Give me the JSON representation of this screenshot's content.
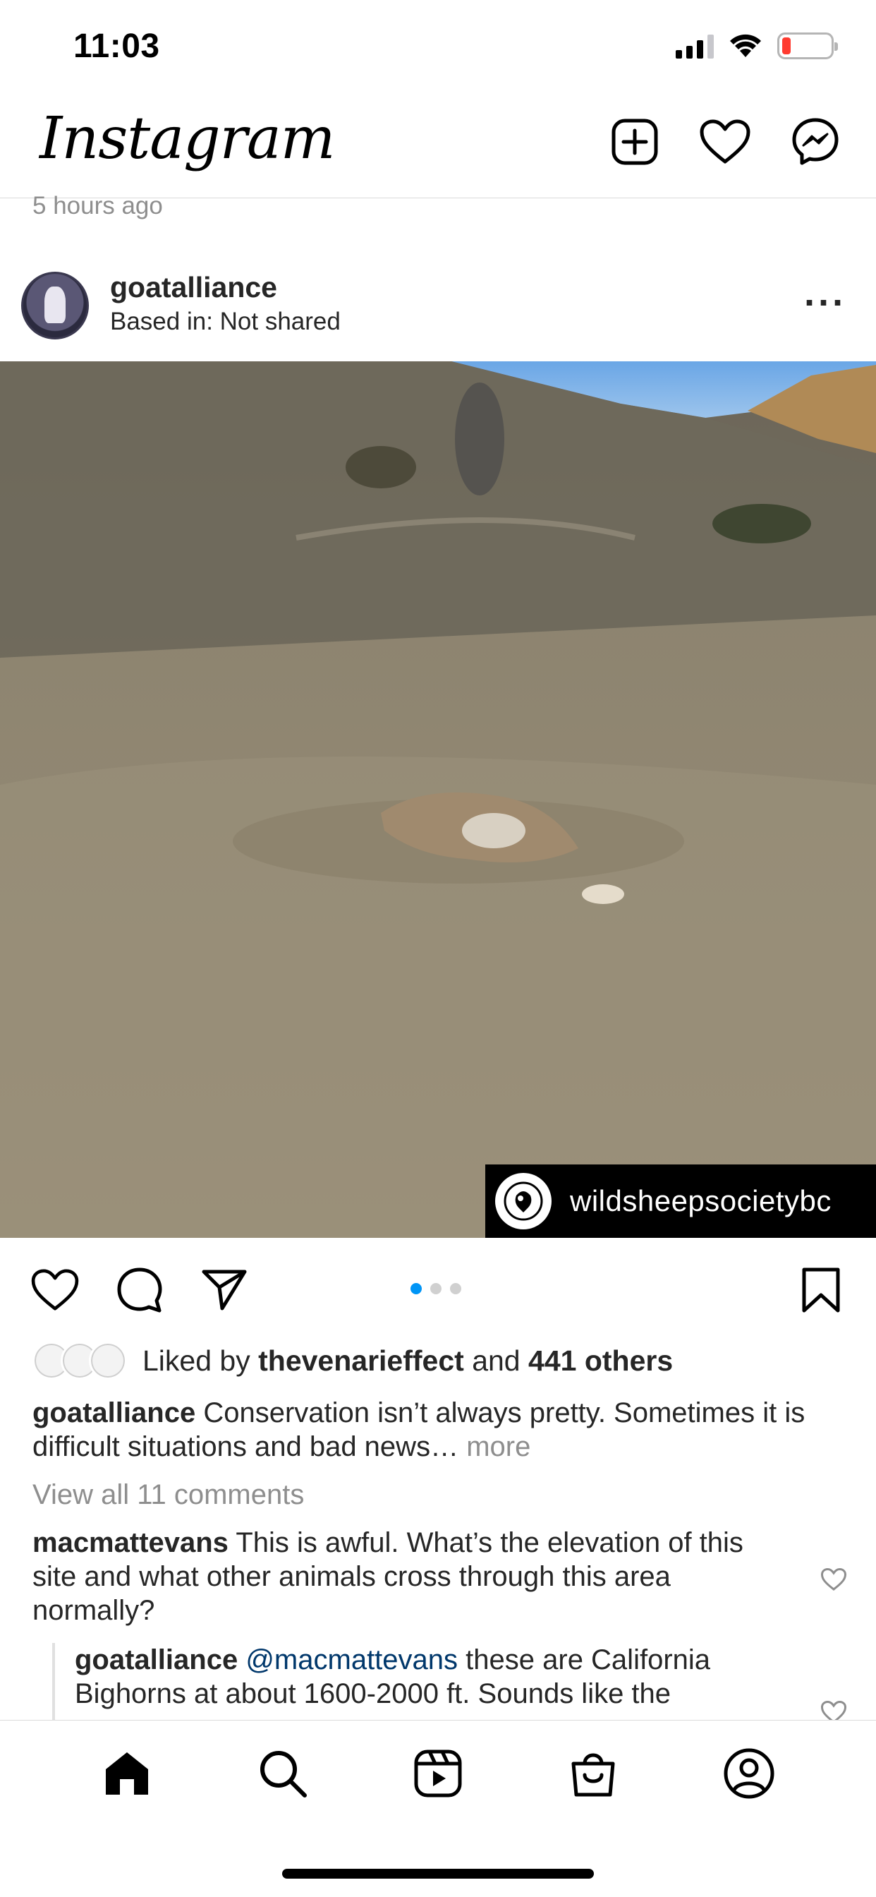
{
  "status": {
    "time": "11:03"
  },
  "header": {
    "logo": "Instagram",
    "icons": [
      "new-post-icon",
      "heart-icon",
      "messenger-icon"
    ]
  },
  "previous_post": {
    "time_ago": "5 hours ago"
  },
  "post": {
    "username": "goatalliance",
    "location": "Based in: Not shared",
    "watermark": "wildsheepsocietybc",
    "carousel": {
      "total": 3,
      "active": 1
    },
    "likes": {
      "prefix": "Liked by",
      "user": "thevenarieffect",
      "and": "and",
      "count": "441 others"
    },
    "caption": {
      "username": "goatalliance",
      "text": "Conservation isn’t always pretty. Sometimes it is difficult situations and bad news…",
      "more": "more"
    },
    "view_comments": "View all 11 comments",
    "comments": [
      {
        "username": "macmattevans",
        "text": "This is awful. What’s the elevation of this site and what other animals cross through this area normally?"
      },
      {
        "username": "goatalliance",
        "mention": "@macmattevans",
        "text": "these are California Bighorns at about 1600-2000 ft. Sounds like the"
      }
    ]
  },
  "tabs": [
    "home-icon",
    "search-icon",
    "reels-icon",
    "shop-icon",
    "profile-icon"
  ],
  "colors": {
    "accent": "#0095f6",
    "secondary_text": "#8e8e8e",
    "mention": "#00376b",
    "battery_low": "#ff3b30"
  }
}
